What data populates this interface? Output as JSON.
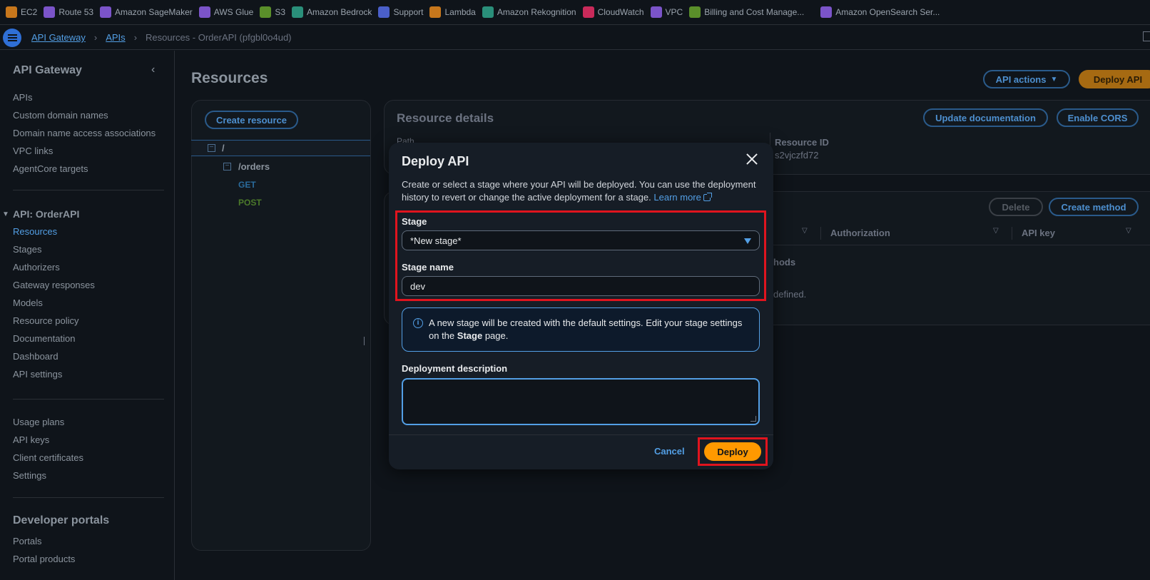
{
  "favorites": [
    {
      "label": "EC2",
      "color": "#c7771c",
      "icon": "ec2-icon"
    },
    {
      "label": "Route 53",
      "color": "#7b54c9",
      "icon": "route53-icon"
    },
    {
      "label": "Amazon SageMaker",
      "color": "#7b54c9",
      "icon": "sagemaker-icon"
    },
    {
      "label": "AWS Glue",
      "color": "#7b54c9",
      "icon": "glue-icon"
    },
    {
      "label": "S3",
      "color": "#5a8f2a",
      "icon": "s3-icon"
    },
    {
      "label": "Amazon Bedrock",
      "color": "#2a8f7a",
      "icon": "bedrock-icon"
    },
    {
      "label": "Support",
      "color": "#4a5fc9",
      "icon": "support-icon"
    },
    {
      "label": "Lambda",
      "color": "#c7771c",
      "icon": "lambda-icon"
    },
    {
      "label": "Amazon Rekognition",
      "color": "#2a8f7a",
      "icon": "rekognition-icon"
    },
    {
      "label": "CloudWatch",
      "color": "#c92a5a",
      "icon": "cloudwatch-icon"
    },
    {
      "label": "VPC",
      "color": "#7b54c9",
      "icon": "vpc-icon"
    },
    {
      "label": "Billing and Cost Manage...",
      "color": "#5a8f2a",
      "icon": "billing-icon"
    },
    {
      "label": "Amazon OpenSearch Ser...",
      "color": "#7b54c9",
      "icon": "opensearch-icon"
    }
  ],
  "breadcrumb": {
    "root": "API Gateway",
    "apis": "APIs",
    "current": "Resources - OrderAPI (pfgbl0o4ud)"
  },
  "sidebar": {
    "title": "API Gateway",
    "top_items": [
      "APIs",
      "Custom domain names",
      "Domain name access associations",
      "VPC links",
      "AgentCore targets"
    ],
    "api_section": "API: OrderAPI",
    "api_items": [
      "Resources",
      "Stages",
      "Authorizers",
      "Gateway responses",
      "Models",
      "Resource policy",
      "Documentation",
      "Dashboard",
      "API settings"
    ],
    "bottom_items": [
      "Usage plans",
      "API keys",
      "Client certificates",
      "Settings"
    ],
    "dev_section": "Developer portals",
    "dev_items": [
      "Portals",
      "Portal products"
    ]
  },
  "main": {
    "title": "Resources",
    "api_actions": "API actions",
    "deploy_api": "Deploy API",
    "create_resource": "Create resource",
    "tree_root": "/",
    "tree_orders": "/orders",
    "method_get": "GET",
    "method_post": "POST",
    "resource_details": "Resource details",
    "update_documentation": "Update documentation",
    "enable_cors": "Enable CORS",
    "path_label": "Path",
    "resource_id_label": "Resource ID",
    "resource_id_value": "s2vjczfd72",
    "delete": "Delete",
    "create_method": "Create method",
    "col_authorization": "Authorization",
    "col_api_key": "API key",
    "methods_partial": "hods",
    "defined_partial": "defined."
  },
  "modal": {
    "title": "Deploy API",
    "description": "Create or select a stage where your API will be deployed. You can use the deployment history to revert or change the active deployment for a stage.",
    "learn_more": "Learn more",
    "stage_label": "Stage",
    "stage_value": "*New stage*",
    "stage_name_label": "Stage name",
    "stage_name_value": "dev",
    "info_pre": "A new stage will be created with the default settings. Edit your stage settings on the",
    "info_bold": "Stage",
    "info_post": "page.",
    "deployment_description_label": "Deployment description",
    "deployment_description_value": "",
    "cancel": "Cancel",
    "deploy": "Deploy"
  }
}
